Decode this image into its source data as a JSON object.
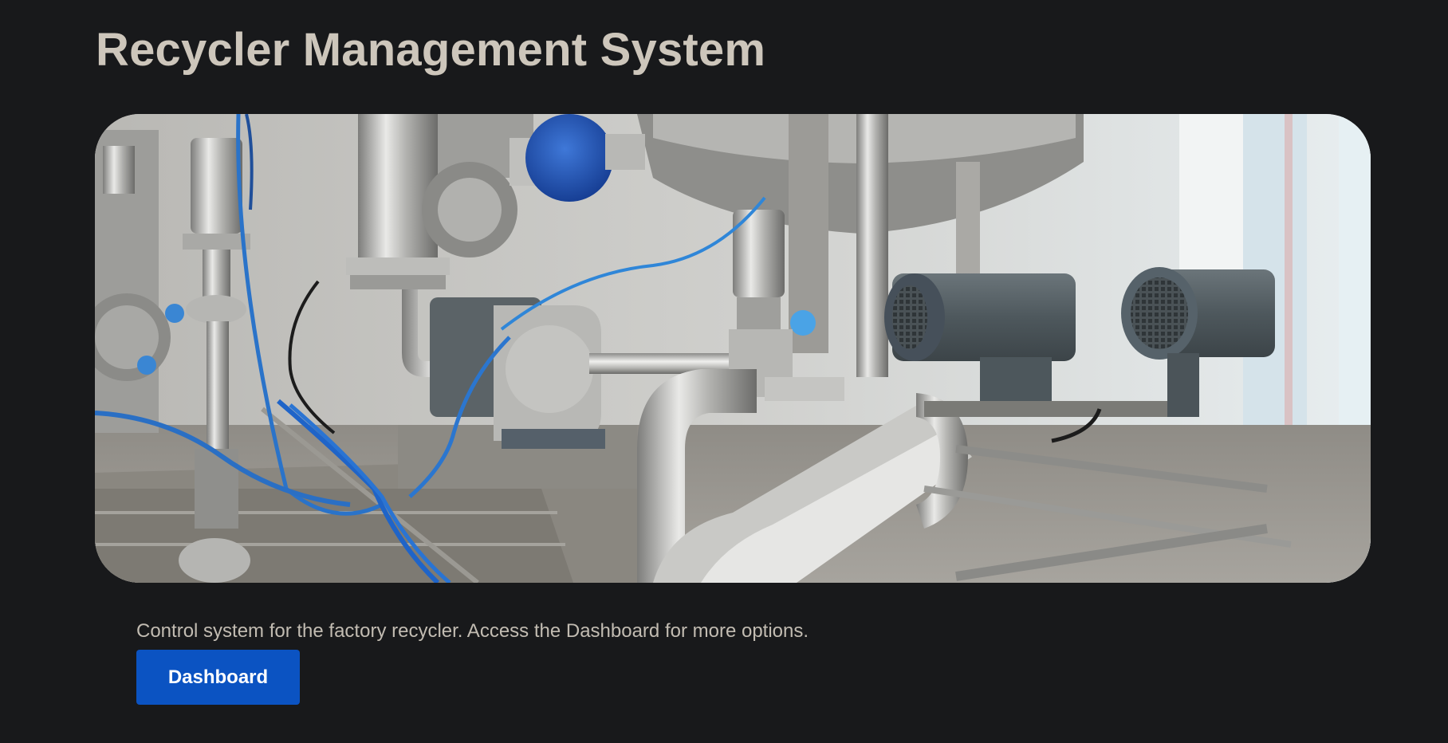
{
  "page": {
    "title": "Recycler Management System",
    "description": "Control system for the factory recycler. Access the Dashboard for more options."
  },
  "hero_image": {
    "subject": "industrial-machinery-photo"
  },
  "actions": {
    "dashboard_label": "Dashboard"
  },
  "colors": {
    "background": "#18191b",
    "title_text": "#cdc6bb",
    "body_text": "#c2bcb2",
    "button": "#0b53c2",
    "button_text": "#ffffff"
  }
}
